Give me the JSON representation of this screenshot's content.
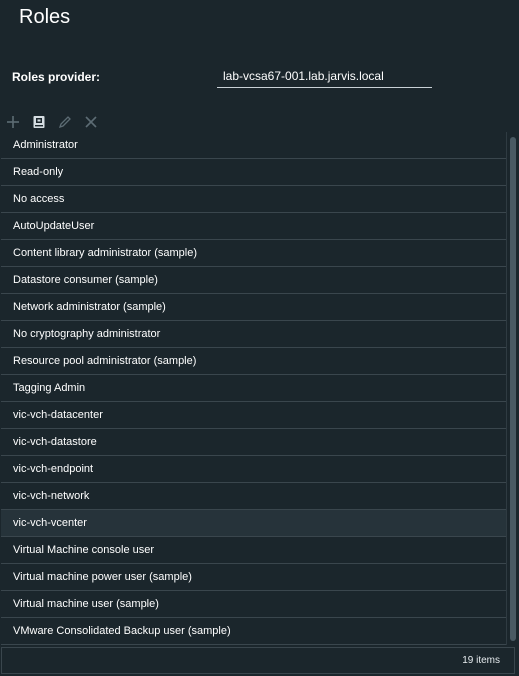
{
  "page": {
    "title": "Roles"
  },
  "provider": {
    "label": "Roles provider:",
    "value": "lab-vcsa67-001.lab.jarvis.local"
  },
  "toolbar": {
    "icons": [
      "add-icon",
      "clone-icon",
      "edit-icon",
      "delete-icon"
    ],
    "active_color": "#d5dde2",
    "disabled_color": "#5d6c74"
  },
  "roles": [
    "Administrator",
    "Read-only",
    "No access",
    "AutoUpdateUser",
    "Content library administrator (sample)",
    "Datastore consumer (sample)",
    "Network administrator (sample)",
    "No cryptography administrator",
    "Resource pool administrator (sample)",
    "Tagging Admin",
    "vic-vch-datacenter",
    "vic-vch-datastore",
    "vic-vch-endpoint",
    "vic-vch-network",
    "vic-vch-vcenter",
    "Virtual Machine console user",
    "Virtual machine power user (sample)",
    "Virtual machine user (sample)",
    "VMware Consolidated Backup user (sample)"
  ],
  "selected_role": "vic-vch-vcenter",
  "footer": {
    "item_count": "19 items"
  }
}
